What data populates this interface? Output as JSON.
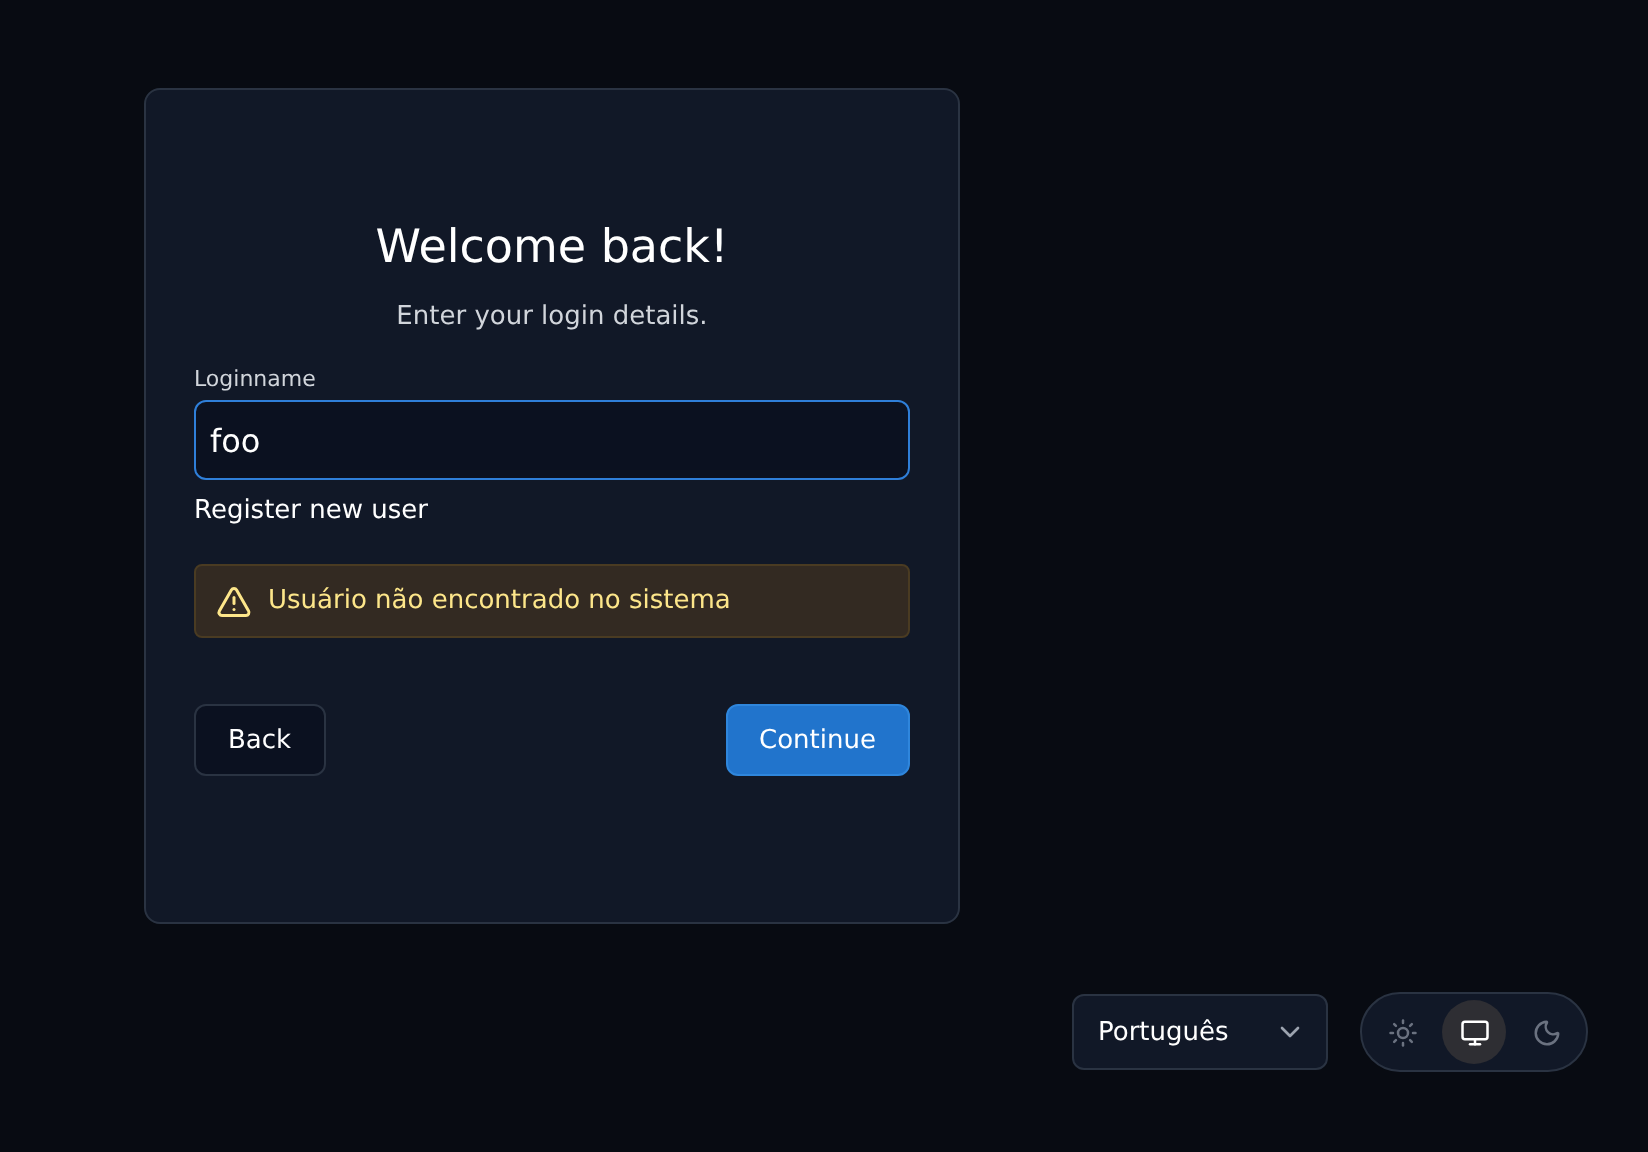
{
  "card": {
    "title": "Welcome back!",
    "subtitle": "Enter your login details.",
    "field": {
      "label": "Loginname",
      "value": "foo"
    },
    "register_link": "Register new user",
    "alert": {
      "kind": "warning",
      "text": "Usuário não encontrado no sistema"
    },
    "buttons": [
      {
        "label": "Back",
        "kind": "secondary"
      },
      {
        "label": "Continue",
        "kind": "primary"
      }
    ]
  },
  "language": {
    "value": "Português"
  },
  "theme_toggle": [
    {
      "kind": "light",
      "selected": false
    },
    {
      "kind": "system",
      "selected": true
    },
    {
      "kind": "dark",
      "selected": false
    }
  ]
}
